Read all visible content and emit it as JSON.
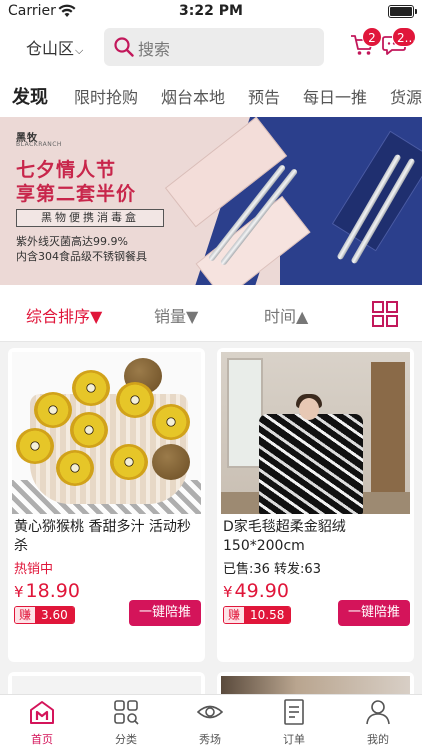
{
  "status_bar": {
    "carrier": "Carrier",
    "time": "3:22 PM"
  },
  "header": {
    "location": "仓山区",
    "search_placeholder": "搜索",
    "cart_badge": "2",
    "message_badge": "2..."
  },
  "category_tabs": [
    "发现",
    "限时抢购",
    "烟台本地",
    "预告",
    "每日一推",
    "货源"
  ],
  "banner": {
    "brand": "黑牧",
    "brand_sub": "BLACKRANCH",
    "headline_1": "七夕情人节",
    "headline_2": "享第二套半价",
    "box_label": "黑物便携消毒盒",
    "line_1": "紫外线灭菌高达99.9%",
    "line_2": "内含304食品级不锈钢餐具"
  },
  "sort_options": [
    "综合排序▼",
    "销量▼",
    "时间▲"
  ],
  "products": [
    {
      "title": "黄心猕猴桃 香甜多汁 活动秒杀",
      "tag": "热销中",
      "stats": "",
      "currency": "¥",
      "price": "18.90",
      "earn_label": "赚",
      "earn_value": "3.60",
      "push_label": "一键陪推"
    },
    {
      "title": "D家毛毯超柔金貂绒150*200cm",
      "tag": "",
      "stats": "已售:36  转发:63",
      "currency": "¥",
      "price": "49.90",
      "earn_label": "赚",
      "earn_value": "10.58",
      "push_label": "一键陪推"
    }
  ],
  "tab_bar": [
    {
      "label": "首页",
      "icon": "home-icon"
    },
    {
      "label": "分类",
      "icon": "category-icon"
    },
    {
      "label": "秀场",
      "icon": "eye-icon"
    },
    {
      "label": "订单",
      "icon": "order-icon"
    },
    {
      "label": "我的",
      "icon": "profile-icon"
    }
  ],
  "colors": {
    "accent": "#e0163a",
    "button": "#d4145a"
  }
}
